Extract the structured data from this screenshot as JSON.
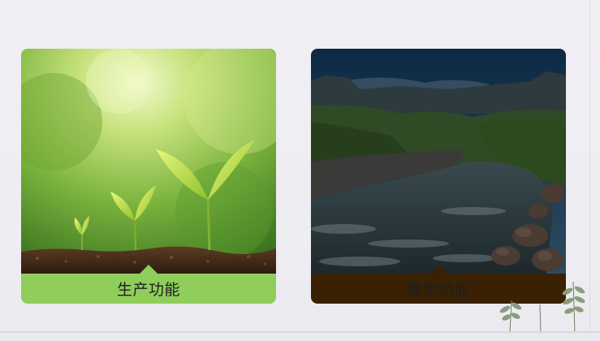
{
  "cards": [
    {
      "title": "生产功能",
      "image": "seedlings-in-soil"
    },
    {
      "title": "稳定功能",
      "image": "mountain-river-valley"
    }
  ],
  "decoration": "leaf-sprigs",
  "colors": {
    "background": "#efeef3",
    "production_caption_bg": "#8fce5a",
    "stability_caption_bg": "#3a2104",
    "caption_text": "#1e1e1e"
  }
}
